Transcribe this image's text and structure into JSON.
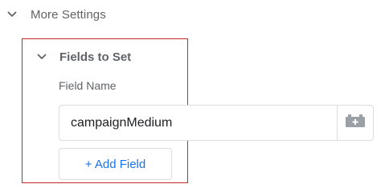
{
  "more_settings": {
    "label": "More Settings",
    "icon": "chevron-down-icon"
  },
  "fields_to_set": {
    "label": "Fields to Set",
    "icon": "chevron-down-icon",
    "field_name_label": "Field Name",
    "field_value": "campaignMedium",
    "variable_icon": "variable-brick-icon",
    "add_field_label": "+ Add Field"
  },
  "colors": {
    "highlight": "#c62828",
    "link": "#1a73e8",
    "muted_text": "#5f6368",
    "border": "#dadce0"
  }
}
